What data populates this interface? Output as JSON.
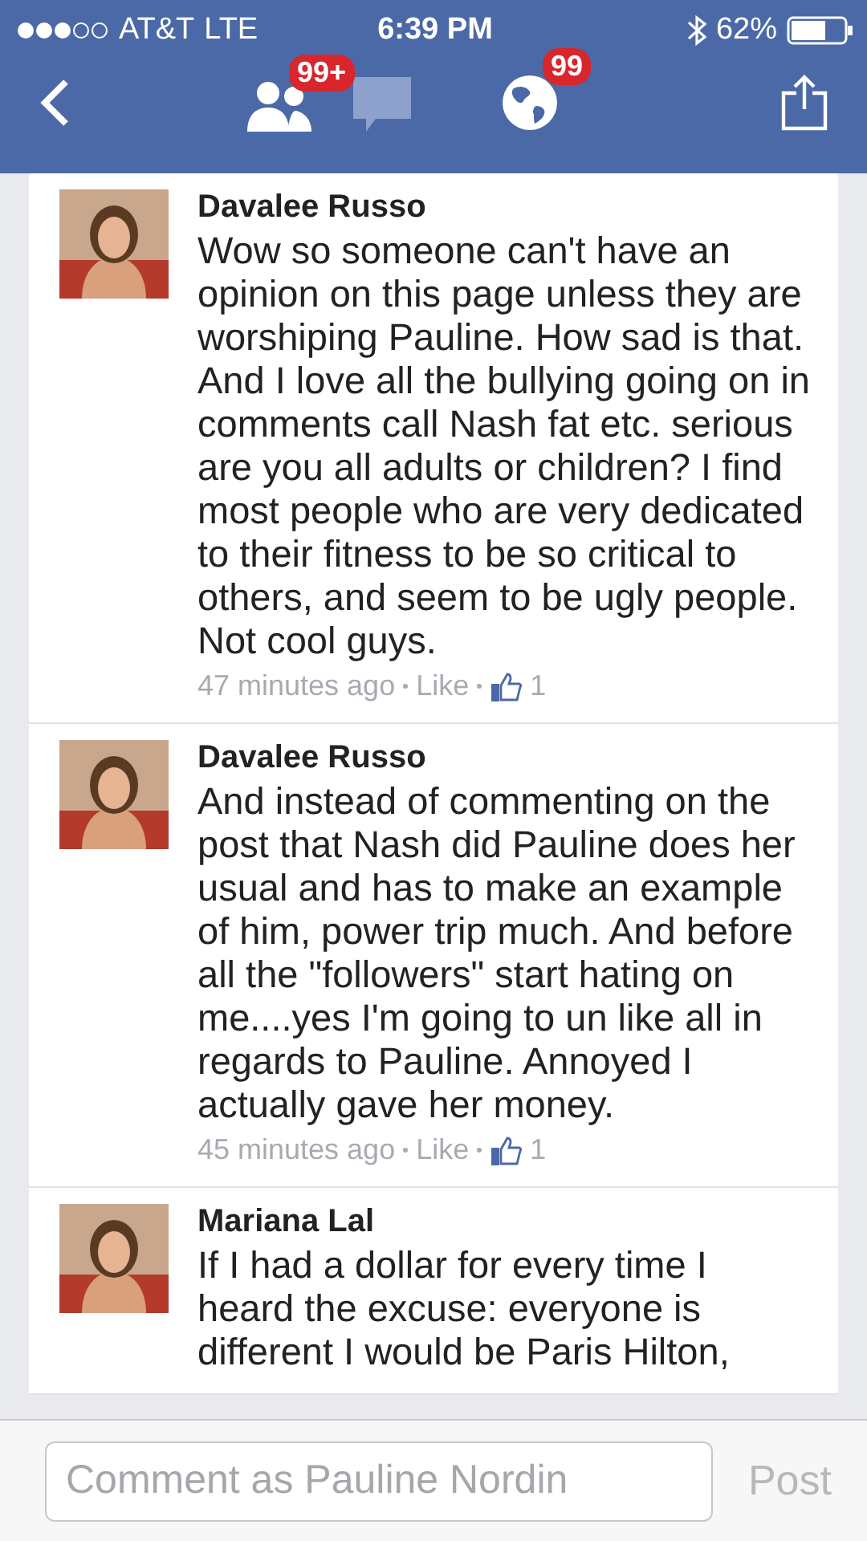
{
  "status_bar": {
    "carrier": "AT&T",
    "network": "LTE",
    "time": "6:39 PM",
    "battery": "62%"
  },
  "nav": {
    "friends_badge": "99+",
    "notifications_badge": "99"
  },
  "comments": [
    {
      "author": "Davalee Russo",
      "text": "Wow so someone can't have an opinion on this page unless they are worshiping Pauline. How sad is that. And I love all the bullying going on in comments call Nash fat etc. serious are you all adults or children? I find most people who are very dedicated to their fitness to be so critical to others, and seem to be ugly people. Not cool guys.",
      "time": "47 minutes ago",
      "like": "Like",
      "likes": "1"
    },
    {
      "author": "Davalee Russo",
      "text": "And instead of commenting on the post that Nash did Pauline does her usual and has to make an example of him, power trip much. And before all the \"followers\" start hating on me....yes I'm going to un like all in regards to Pauline. Annoyed I actually gave her money.",
      "time": "45 minutes ago",
      "like": "Like",
      "likes": "1"
    },
    {
      "author": "Mariana Lal",
      "text": "If I had a dollar for every time I heard the excuse: everyone is different I would be Paris Hilton,"
    }
  ],
  "composer": {
    "placeholder": "Comment as Pauline Nordin",
    "post": "Post"
  }
}
